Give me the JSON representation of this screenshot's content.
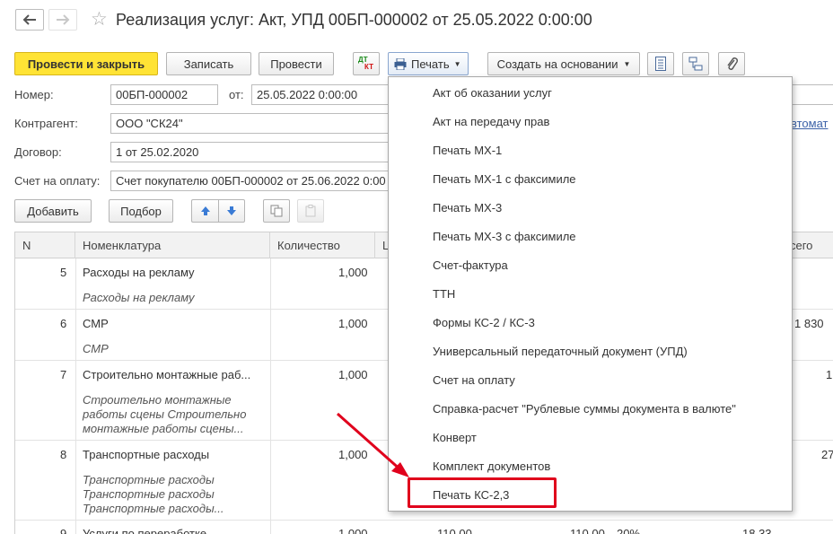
{
  "window": {
    "title": "Реализация услуг: Акт, УПД 00БП-000002 от 25.05.2022 0:00:00"
  },
  "toolbar": {
    "post_close": "Провести и закрыть",
    "save": "Записать",
    "post": "Провести",
    "dt_kt_top": "ДТ",
    "dt_kt_bottom": "КТ",
    "print": "Печать",
    "create_based": "Создать на основании"
  },
  "form": {
    "number_label": "Номер:",
    "number_value": "00БП-000002",
    "date_label": "от:",
    "date_value": "25.05.2022  0:00:00",
    "counterparty_label": "Контрагент:",
    "counterparty_value": "ООО \"СК24\"",
    "counterparty_link": "втомат",
    "contract_label": "Договор:",
    "contract_value": "1 от 25.02.2020",
    "invoice_label": "Счет на оплату:",
    "invoice_value": "Счет покупателю 00БП-000002 от 25.06.2022 0:00"
  },
  "table_toolbar": {
    "add": "Добавить",
    "select": "Подбор"
  },
  "table": {
    "headers": {
      "n": "N",
      "item": "Номенклатура",
      "qty": "Количество",
      "price": "Ц",
      "total": "сего"
    },
    "rows": [
      {
        "n": "5",
        "name": "Расходы на рекламу",
        "qty": "1,000",
        "sub": [
          "Расходы на рекламу"
        ],
        "total": ""
      },
      {
        "n": "6",
        "name": "СМР",
        "qty": "1,000",
        "sub": [
          "СМР"
        ],
        "total": "1 830"
      },
      {
        "n": "7",
        "name": "Строительно монтажные раб...",
        "qty": "1,000",
        "sub": [
          "Строительно монтажные",
          "работы сцены Строительно",
          "монтажные работы сцены..."
        ],
        "total": "1"
      },
      {
        "n": "8",
        "name": "Транспортные расходы",
        "qty": "1,000",
        "sub": [
          "Транспортные расходы",
          "Транспортные расходы",
          "Транспортные расходы..."
        ],
        "total": "27"
      },
      {
        "n": "9",
        "name": "Услуги по переработке",
        "qty": "1,000",
        "price": "110,00",
        "price2": "110,00",
        "vat": "20%",
        "vat_sum": "18,33"
      }
    ]
  },
  "print_menu": {
    "items": [
      "Акт об оказании услуг",
      "Акт на передачу прав",
      "Печать МХ-1",
      "Печать МХ-1 с факсимиле",
      "Печать МХ-3",
      "Печать МХ-3 с факсимиле",
      "Счет-фактура",
      "ТТН",
      "Формы КС-2 / КС-3",
      "Универсальный передаточный документ (УПД)",
      "Счет на оплату",
      "Справка-расчет \"Рублевые суммы документа в валюте\"",
      "Конверт",
      "Комплект документов",
      "Печать КС-2,3"
    ]
  },
  "colors": {
    "primary_button": "#ffe335",
    "highlight": "#e0001c",
    "link": "#3c62a8"
  }
}
